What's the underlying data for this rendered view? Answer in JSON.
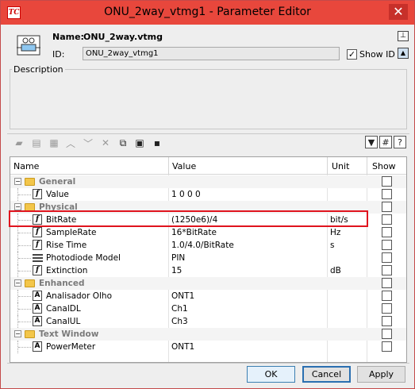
{
  "window": {
    "title": "ONU_2way_vtmg1 - Parameter Editor",
    "app_icon_text": "TC",
    "close_glyph": "✕"
  },
  "header": {
    "name_label": "Name:",
    "name_value": "ONU_2way.vtmg",
    "id_label": "ID:",
    "id_value": "ONU_2way_vtmg1",
    "show_id_label": "Show ID",
    "show_id_checked": true
  },
  "description": {
    "label": "Description",
    "text": ""
  },
  "toolbar": {
    "left_icons": [
      "add-folder-icon",
      "add-parameter-icon",
      "add-group-icon",
      "move-up-icon",
      "move-down-icon",
      "delete-icon",
      "copy-icon",
      "paste-icon",
      "save-icon"
    ],
    "right_icons": [
      "filter-icon",
      "grid-icon",
      "help-icon"
    ]
  },
  "table": {
    "columns": [
      "Name",
      "Value",
      "Unit",
      "Show"
    ],
    "rows": [
      {
        "kind": "group",
        "name": "General"
      },
      {
        "kind": "param",
        "icon": "f",
        "name": "Value",
        "value": "1 0 0 0",
        "unit": ""
      },
      {
        "kind": "group",
        "name": "Physical"
      },
      {
        "kind": "param",
        "icon": "f",
        "name": "BitRate",
        "value": "(1250e6)/4",
        "unit": "bit/s"
      },
      {
        "kind": "param",
        "icon": "f",
        "name": "SampleRate",
        "value": "16*BitRate",
        "unit": "Hz"
      },
      {
        "kind": "param",
        "icon": "f",
        "name": "Rise Time",
        "value": "1.0/4.0/BitRate",
        "unit": "s"
      },
      {
        "kind": "param",
        "icon": "list",
        "name": "Photodiode Model",
        "value": "PIN",
        "unit": ""
      },
      {
        "kind": "param",
        "icon": "f",
        "name": "Extinction",
        "value": "15",
        "unit": "dB"
      },
      {
        "kind": "group",
        "name": "Enhanced"
      },
      {
        "kind": "param",
        "icon": "A",
        "name": "Analisador Olho",
        "value": "ONT1",
        "unit": ""
      },
      {
        "kind": "param",
        "icon": "A",
        "name": "CanalDL",
        "value": "Ch1",
        "unit": ""
      },
      {
        "kind": "param",
        "icon": "A",
        "name": "CanalUL",
        "value": "Ch3",
        "unit": ""
      },
      {
        "kind": "group",
        "name": "Text Window"
      },
      {
        "kind": "param",
        "icon": "A",
        "name": "PowerMeter",
        "value": "ONT1",
        "unit": ""
      }
    ]
  },
  "buttons": {
    "ok": "OK",
    "cancel": "Cancel",
    "apply": "Apply"
  },
  "colors": {
    "titlebar": "#e8473c",
    "close": "#c7302a",
    "highlight": "#e0141e",
    "folder": "#f3c64a"
  }
}
